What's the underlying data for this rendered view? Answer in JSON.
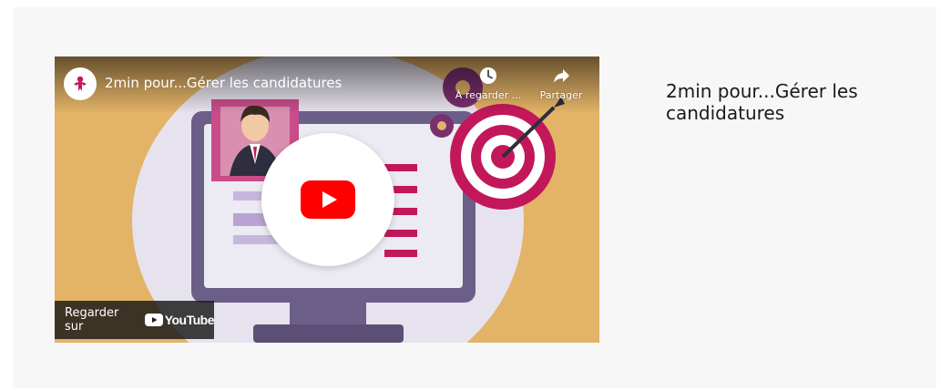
{
  "section": {
    "heading": "2min pour...Gérer les candidatures"
  },
  "video": {
    "title": "2min pour...Gérer les candidatures",
    "watch_later_label": "À regarder ...",
    "share_label": "Partager",
    "watch_on_label": "Regarder sur",
    "platform_name": "YouTube"
  },
  "icons": {
    "channel": "channel-logo-icon",
    "watch_later": "clock-icon",
    "share": "share-arrow-icon",
    "play": "youtube-play-icon"
  },
  "colors": {
    "youtube_red": "#ff0000",
    "accent_pink": "#c2185b",
    "thumbnail_background": "#e3b367"
  }
}
